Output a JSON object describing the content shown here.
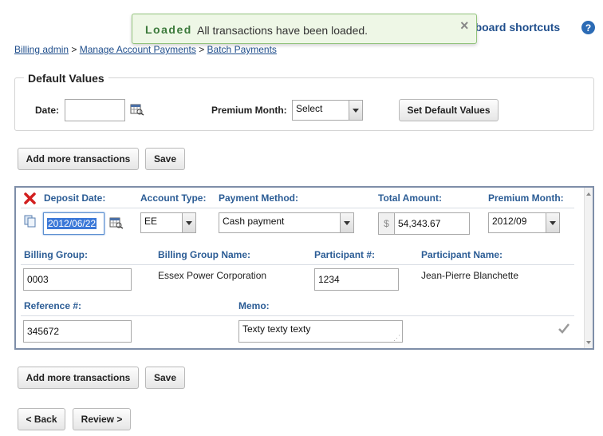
{
  "toast": {
    "title": "Loaded",
    "message": "All transactions have been loaded.",
    "close_glyph": "×"
  },
  "header": {
    "shortcuts_label": "eyboard shortcuts",
    "help_glyph": "?"
  },
  "breadcrumb": {
    "items": [
      "Billing admin",
      "Manage Account Payments",
      "Batch Payments"
    ],
    "separator": ">"
  },
  "defaults": {
    "legend": "Default Values",
    "date_label": "Date:",
    "date_value": "",
    "premium_month_label": "Premium Month:",
    "premium_month_value": "Select",
    "set_button": "Set Default Values"
  },
  "actions_top": {
    "add_more": "Add more transactions",
    "save": "Save"
  },
  "transaction": {
    "headers": {
      "deposit_date": "Deposit Date:",
      "account_type": "Account Type:",
      "payment_method": "Payment Method:",
      "total_amount": "Total Amount:",
      "premium_month": "Premium Month:",
      "billing_group": "Billing Group:",
      "billing_group_name": "Billing Group Name:",
      "participant_no": "Participant #:",
      "participant_name": "Participant Name:",
      "reference_no": "Reference #:",
      "memo": "Memo:"
    },
    "values": {
      "deposit_date": "2012/06/22",
      "account_type": "EE",
      "payment_method": "Cash payment",
      "currency": "$",
      "total_amount": "54,343.67",
      "premium_month": "2012/09",
      "billing_group": "0003",
      "billing_group_name": "Essex Power Corporation",
      "participant_no": "1234",
      "participant_name": "Jean-Pierre Blanchette",
      "reference_no": "345672",
      "memo": "Texty texty texty"
    }
  },
  "actions_bottom": {
    "add_more": "Add more transactions",
    "save": "Save"
  },
  "nav": {
    "back": "< Back",
    "review": "Review >"
  },
  "colors": {
    "toast_bg": "#eef7e6",
    "toast_border": "#93c47d",
    "toast_title": "#3c7a3c",
    "link": "#1f4e8c",
    "label_blue": "#2b5c95",
    "delete_red": "#d21f1f",
    "panel_border": "#7e8ea8"
  }
}
